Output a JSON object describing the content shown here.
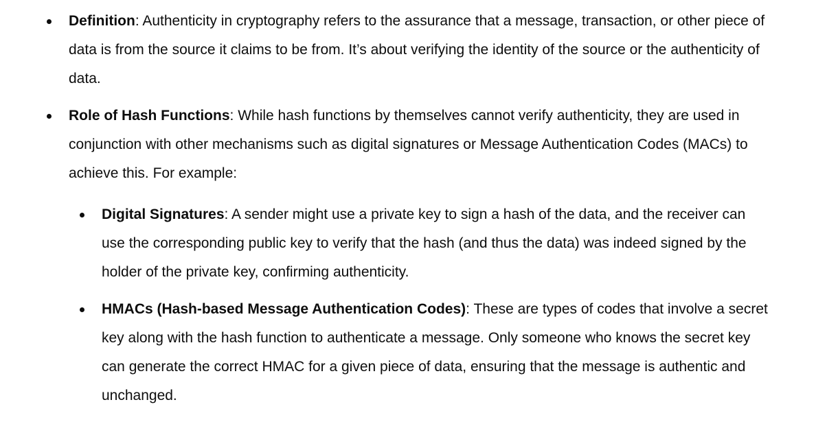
{
  "items": [
    {
      "term": "Definition",
      "sep": ":",
      "text": " Authenticity in cryptography refers to the assurance that a message, transaction, or other piece of data is from the source it claims to be from. It’s about verifying the identity of the source or the authenticity of data."
    },
    {
      "term": "Role of Hash Functions",
      "sep": ":",
      "text": " While hash functions by themselves cannot verify authenticity, they are used in conjunction with other mechanisms such as digital signatures or Message Authentication Codes (MACs) to achieve this. For example:",
      "subitems": [
        {
          "term": "Digital Signatures",
          "sep": ":",
          "text": " A sender might use a private key to sign a hash of the data, and the receiver can use the corresponding public key to verify that the hash (and thus the data) was indeed signed by the holder of the private key, confirming authenticity."
        },
        {
          "term": "HMACs (Hash-based Message Authentication Codes)",
          "sep": ":",
          "text": " These are types of codes that involve a secret key along with the hash function to authenticate a message. Only someone who knows the secret key can generate the correct HMAC for a given piece of data, ensuring that the message is authentic and unchanged."
        }
      ]
    }
  ]
}
